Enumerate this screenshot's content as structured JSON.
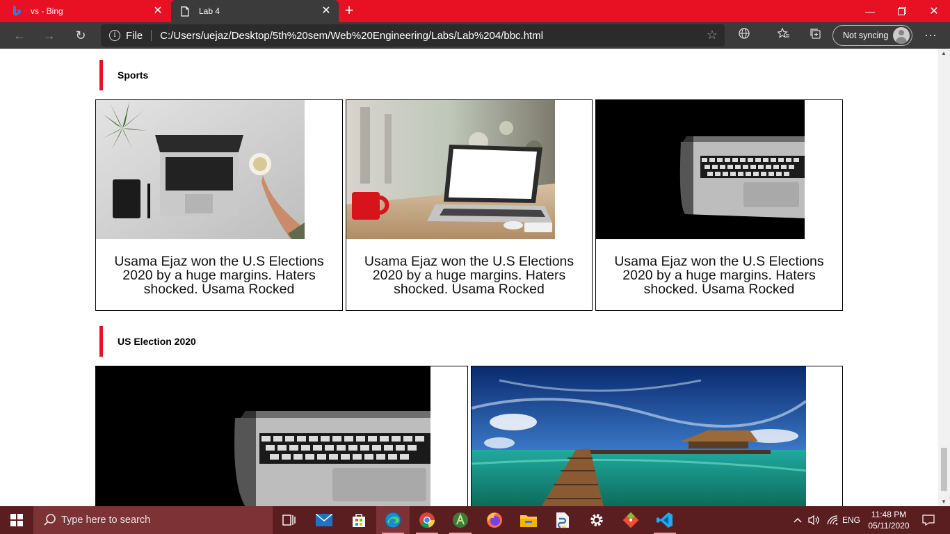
{
  "browser": {
    "tabs": [
      {
        "title": "vs - Bing",
        "active": false
      },
      {
        "title": "Lab 4",
        "active": true
      }
    ],
    "address": {
      "scheme_label": "File",
      "url": "C:/Users/uejaz/Desktop/5th%20sem/Web%20Engineering/Labs/Lab%204/bbc.html"
    },
    "sync_label": "Not syncing",
    "accent_color": "#e81123"
  },
  "page": {
    "sections": [
      {
        "heading": "Sports",
        "cards": [
          {
            "image": "laptop-desk-top-view",
            "caption": "Usama Ejaz won the U.S Elections 2020 by a huge margins. Haters shocked. Usama Rocked"
          },
          {
            "image": "laptop-cafe-red-mug",
            "caption": "Usama Ejaz won the U.S Elections 2020 by a huge margins. Haters shocked. Usama Rocked"
          },
          {
            "image": "laptop-dark-closeup",
            "caption": "Usama Ejaz won the U.S Elections 2020 by a huge margins. Haters shocked. Usama Rocked"
          }
        ]
      },
      {
        "heading": "US Election 2020",
        "cards": [
          {
            "image": "laptop-dark-closeup"
          },
          {
            "image": "tropical-pier-resort"
          }
        ]
      }
    ]
  },
  "taskbar": {
    "search_placeholder": "Type here to search",
    "language": "ENG",
    "time": "11:48 PM",
    "date": "05/11/2020"
  }
}
